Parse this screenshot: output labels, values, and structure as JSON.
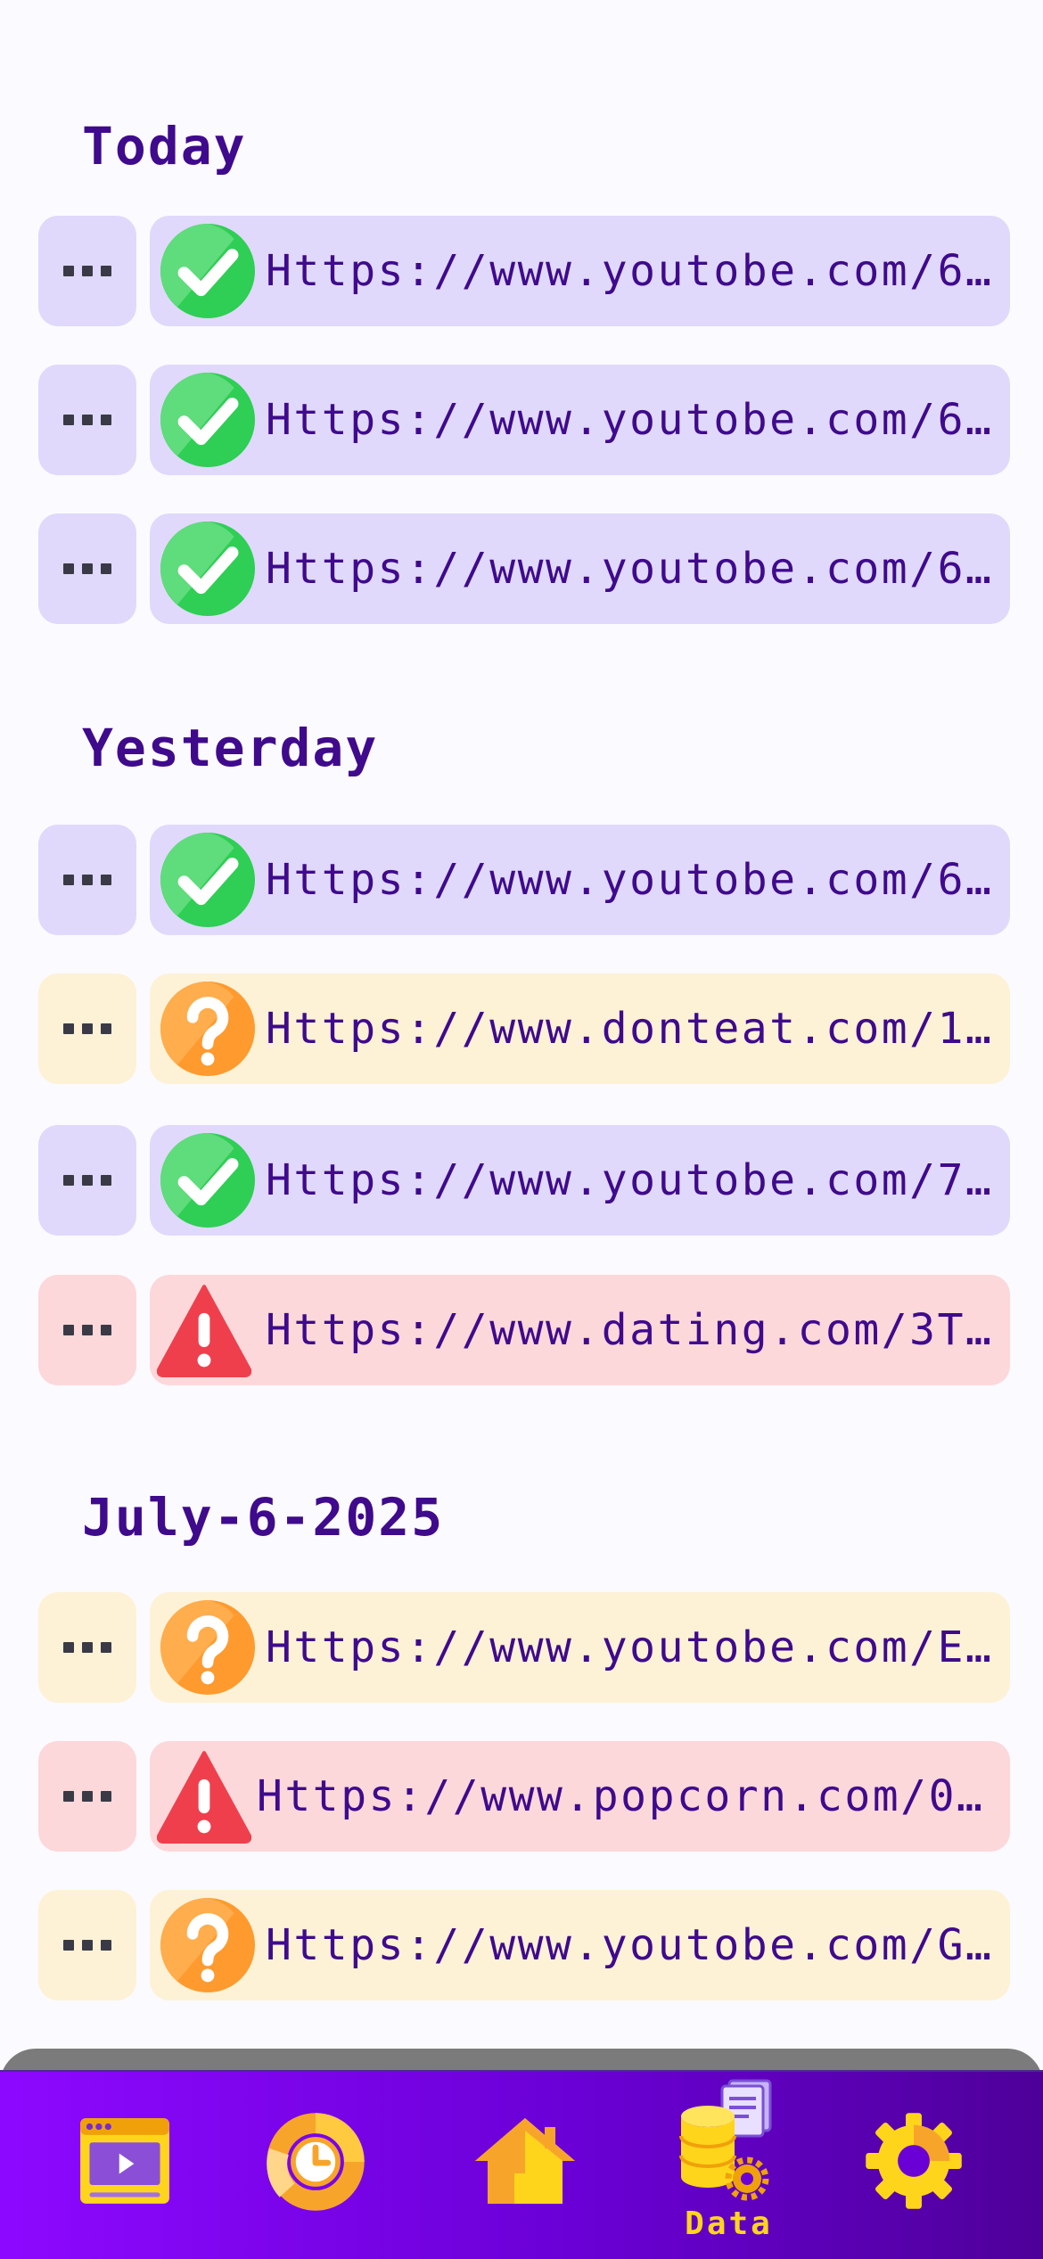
{
  "sections": [
    {
      "title": "Today",
      "items": [
        {
          "status": "safe",
          "url": "Https://www.youtobe.com/6..."
        },
        {
          "status": "safe",
          "url": "Https://www.youtobe.com/6..."
        },
        {
          "status": "safe",
          "url": "Https://www.youtobe.com/6..."
        }
      ]
    },
    {
      "title": "Yesterday",
      "items": [
        {
          "status": "safe",
          "url": "Https://www.youtobe.com/6..."
        },
        {
          "status": "unknown",
          "url": "Https://www.donteat.com/1..."
        },
        {
          "status": "safe",
          "url": "Https://www.youtobe.com/7..."
        },
        {
          "status": "danger",
          "url": "Https://www.dating.com/3T..."
        }
      ]
    },
    {
      "title": "July-6-2025",
      "items": [
        {
          "status": "unknown",
          "url": "Https://www.youtobe.com/E..."
        },
        {
          "status": "danger",
          "url": "Https://www.popcorn.com/0..."
        },
        {
          "status": "unknown",
          "url": "Https://www.youtobe.com/G..."
        }
      ]
    }
  ],
  "status_icons": {
    "safe": "check-circle-icon",
    "unknown": "question-circle-icon",
    "danger": "warning-triangle-icon"
  },
  "colors": {
    "safe_bg": "#e0d9fb",
    "unknown_bg": "#fdf2d6",
    "danger_bg": "#fcd8da",
    "title_text": "#3f0a8c",
    "nav_icon": "#ffd51c"
  },
  "nav": {
    "items": [
      {
        "icon": "video-window-icon",
        "label": ""
      },
      {
        "icon": "time-chart-icon",
        "label": ""
      },
      {
        "icon": "home-icon",
        "label": ""
      },
      {
        "icon": "database-icon",
        "label": "Data",
        "active": true
      },
      {
        "icon": "gear-icon",
        "label": ""
      }
    ]
  }
}
